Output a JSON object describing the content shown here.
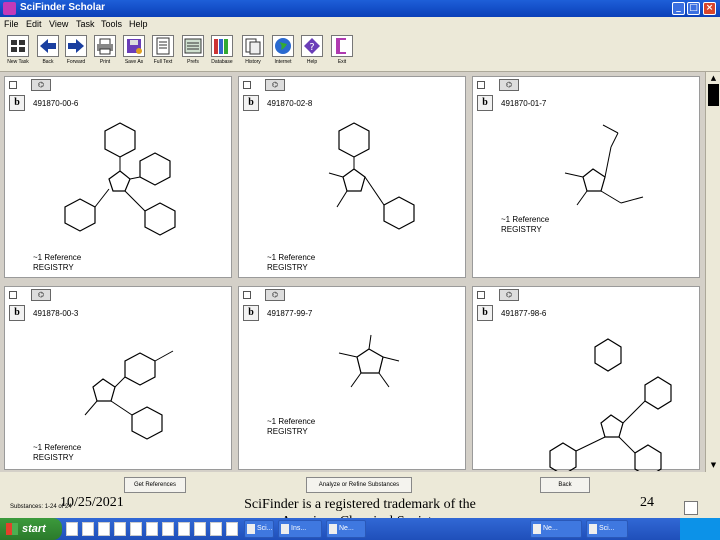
{
  "window": {
    "title": "SciFinder Scholar"
  },
  "menu": [
    "File",
    "Edit",
    "View",
    "Task",
    "Tools",
    "Help"
  ],
  "toolbar": [
    {
      "label": "New Task",
      "icon": "new-task-icon"
    },
    {
      "label": "Back",
      "icon": "back-arrow-icon"
    },
    {
      "label": "Forward",
      "icon": "forward-arrow-icon"
    },
    {
      "label": "Print",
      "icon": "print-icon"
    },
    {
      "label": "Save As",
      "icon": "save-as-icon"
    },
    {
      "label": "Full Text",
      "icon": "full-text-icon"
    },
    {
      "label": "Prefs",
      "icon": "prefs-icon"
    },
    {
      "label": "Database",
      "icon": "database-icon"
    },
    {
      "label": "History",
      "icon": "history-icon"
    },
    {
      "label": "Internet",
      "icon": "internet-icon"
    },
    {
      "label": "Help",
      "icon": "help-icon"
    },
    {
      "label": "Exit",
      "icon": "exit-icon"
    }
  ],
  "results": [
    {
      "regno": "491870-00-6",
      "ref": "~1 Reference",
      "link": "REGISTRY"
    },
    {
      "regno": "491870-02-8",
      "ref": "~1 Reference",
      "link": "REGISTRY"
    },
    {
      "regno": "491870-01-7",
      "ref": "~1 Reference",
      "link": "REGISTRY"
    },
    {
      "regno": "491878-00-3",
      "ref": "~1 Reference",
      "link": "REGISTRY"
    },
    {
      "regno": "491877-99-7",
      "ref": "~1 Reference",
      "link": "REGISTRY"
    },
    {
      "regno": "491877-98-6",
      "ref": "",
      "link": ""
    }
  ],
  "buttons": {
    "get_references": "Get References",
    "analyze": "Analyze or Refine Substances",
    "back": "Back"
  },
  "status": {
    "text": "Substances: 1-24 of 24"
  },
  "slide": {
    "date": "10/25/2021",
    "footer": "SciFinder is a registered trademark of the American Chemical Society",
    "number": "24"
  },
  "taskbar": {
    "start": "start",
    "tasks": [
      "Sci...",
      "Ins...",
      "Ne...",
      "Ne...",
      "Sci..."
    ]
  }
}
